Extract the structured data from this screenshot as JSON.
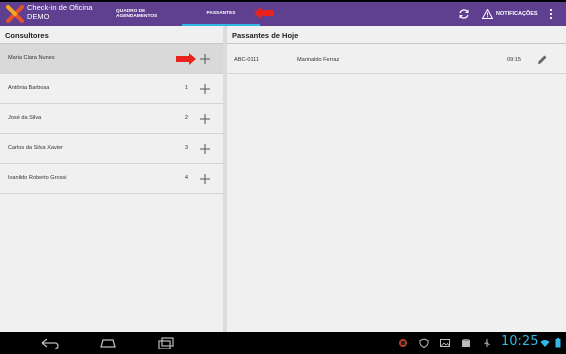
{
  "app": {
    "title_line1": "Check-in de Oficina",
    "title_line2": "DEMO"
  },
  "tabs": [
    {
      "label": "Quadro de agendamentos",
      "selected": false
    },
    {
      "label": "Passantes",
      "selected": true
    }
  ],
  "actions": {
    "notifications_label": "NOTIFICAÇÕES"
  },
  "consultores": {
    "title": "Consultores",
    "items": [
      {
        "name": "Maria Clara Nunes",
        "count": "",
        "selected": true
      },
      {
        "name": "Antônia Barbosa",
        "count": "1",
        "selected": false
      },
      {
        "name": "José da Silva",
        "count": "2",
        "selected": false
      },
      {
        "name": "Carlos da Silva Xavier",
        "count": "3",
        "selected": false
      },
      {
        "name": "Ivanildo Roberto Grossi",
        "count": "4",
        "selected": false
      }
    ]
  },
  "passantes": {
    "title": "Passantes de Hoje",
    "items": [
      {
        "plate": "ABC-0111",
        "name": "Marinaldo Ferraz",
        "time": "09:15"
      }
    ]
  },
  "system": {
    "clock": "10:25"
  },
  "colors": {
    "actionbar": "#5f3f8f",
    "accent": "#33b5e5",
    "annotation_arrow": "#e8231e"
  }
}
